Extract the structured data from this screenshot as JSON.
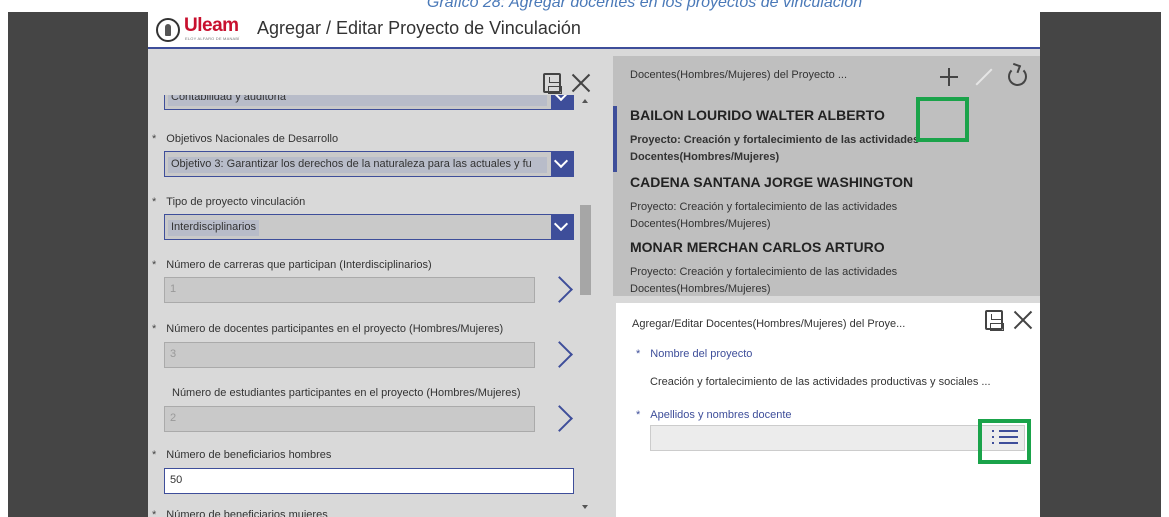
{
  "caption": "Gráfico 28: Agregar docentes en los proyectos de vinculación",
  "app": {
    "logo_text": "Uleam",
    "logo_subtext": "ELOY ALFARO DE MANABÍ",
    "title": "Agregar / Editar Proyecto de Vinculación"
  },
  "form": {
    "fields": [
      {
        "label": "",
        "value": "Contabilidad y auditoria",
        "type": "select"
      },
      {
        "label": "Objetivos Nacionales de Desarrollo",
        "value": "Objetivo 3: Garantizar los derechos de la naturaleza para las actuales y fu",
        "type": "select",
        "required": true
      },
      {
        "label": "Tipo de proyecto vinculación",
        "value": "Interdisciplinarios",
        "type": "select",
        "required": true
      },
      {
        "label": "Número de carreras que participan (Interdisciplinarios)",
        "value": "1",
        "type": "input",
        "required": true
      },
      {
        "label": "Número de docentes participantes en el proyecto (Hombres/Mujeres)",
        "value": "3",
        "type": "input",
        "required": true
      },
      {
        "label": "Número de estudiantes participantes en el proyecto (Hombres/Mujeres)",
        "value": "2",
        "type": "input",
        "required": false
      },
      {
        "label": "Número de beneficiarios hombres",
        "value": "50",
        "type": "input",
        "required": true
      },
      {
        "label": "Número de beneficiarios mujeres",
        "value": "",
        "type": "input",
        "required": true
      }
    ],
    "required_mark": "*"
  },
  "docentes": {
    "title": "Docentes(Hombres/Mujeres) del Proyecto ...",
    "items": [
      {
        "name": "BAILON LOURIDO WALTER ALBERTO",
        "project": "Proyecto: Creación y fortalecimiento de las actividades",
        "type": "Docentes(Hombres/Mujeres)"
      },
      {
        "name": "CADENA SANTANA JORGE WASHINGTON",
        "project": "Proyecto: Creación y fortalecimiento de las actividades",
        "type": "Docentes(Hombres/Mujeres)"
      },
      {
        "name": "MONAR MERCHAN CARLOS ARTURO",
        "project": "Proyecto: Creación y fortalecimiento de las actividades",
        "type": "Docentes(Hombres/Mujeres)"
      }
    ]
  },
  "editor": {
    "title": "Agregar/Editar Docentes(Hombres/Mujeres) del Proye...",
    "project_label": "Nombre del proyecto",
    "project_value": "Creación y fortalecimiento de las actividades productivas y sociales ...",
    "docente_label": "Apellidos y nombres docente",
    "docente_value": ""
  },
  "colors": {
    "accent": "#3e4e9a",
    "highlight": "#1aa34a",
    "brand": "#c8102e"
  },
  "icons": [
    "save-icon",
    "close-icon",
    "add-icon",
    "edit-icon",
    "refresh-icon",
    "chevron-right-icon",
    "chevron-down-icon",
    "list-menu-icon"
  ]
}
